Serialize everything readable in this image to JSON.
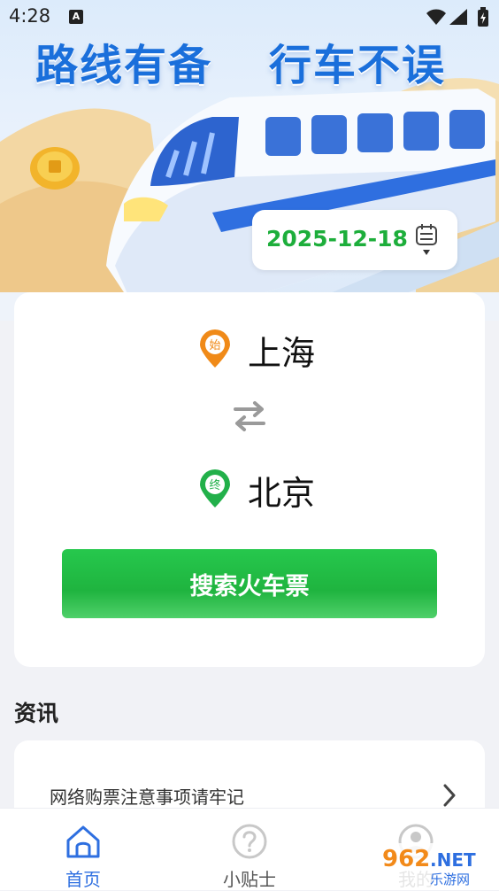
{
  "status_bar": {
    "time": "4:28",
    "notification_letter": "A"
  },
  "hero": {
    "slogan_left": "路线有备",
    "slogan_right": "行车不误",
    "accent_color": "#1a6fdb"
  },
  "date_picker": {
    "value": "2025-12-18",
    "color": "#1dae3b"
  },
  "route": {
    "from": {
      "badge": "始",
      "name": "上海",
      "color": "#f08a18"
    },
    "to": {
      "badge": "终",
      "name": "北京",
      "color": "#22b04a"
    }
  },
  "search": {
    "button_label": "搜索火车票",
    "color": "#1fb43f"
  },
  "news": {
    "heading": "资讯",
    "items": [
      {
        "title": "网络购票注意事项请牢记"
      }
    ]
  },
  "bottom_nav": {
    "items": [
      {
        "label": "首页",
        "icon": "home-icon",
        "active": true
      },
      {
        "label": "小贴士",
        "icon": "question-icon",
        "active": false
      },
      {
        "label": "我的",
        "icon": "user-icon",
        "active": false
      }
    ],
    "active_color": "#2e6fe0"
  },
  "watermark": {
    "brand": "962",
    "suffix": ".NET",
    "caption": "乐游网"
  }
}
